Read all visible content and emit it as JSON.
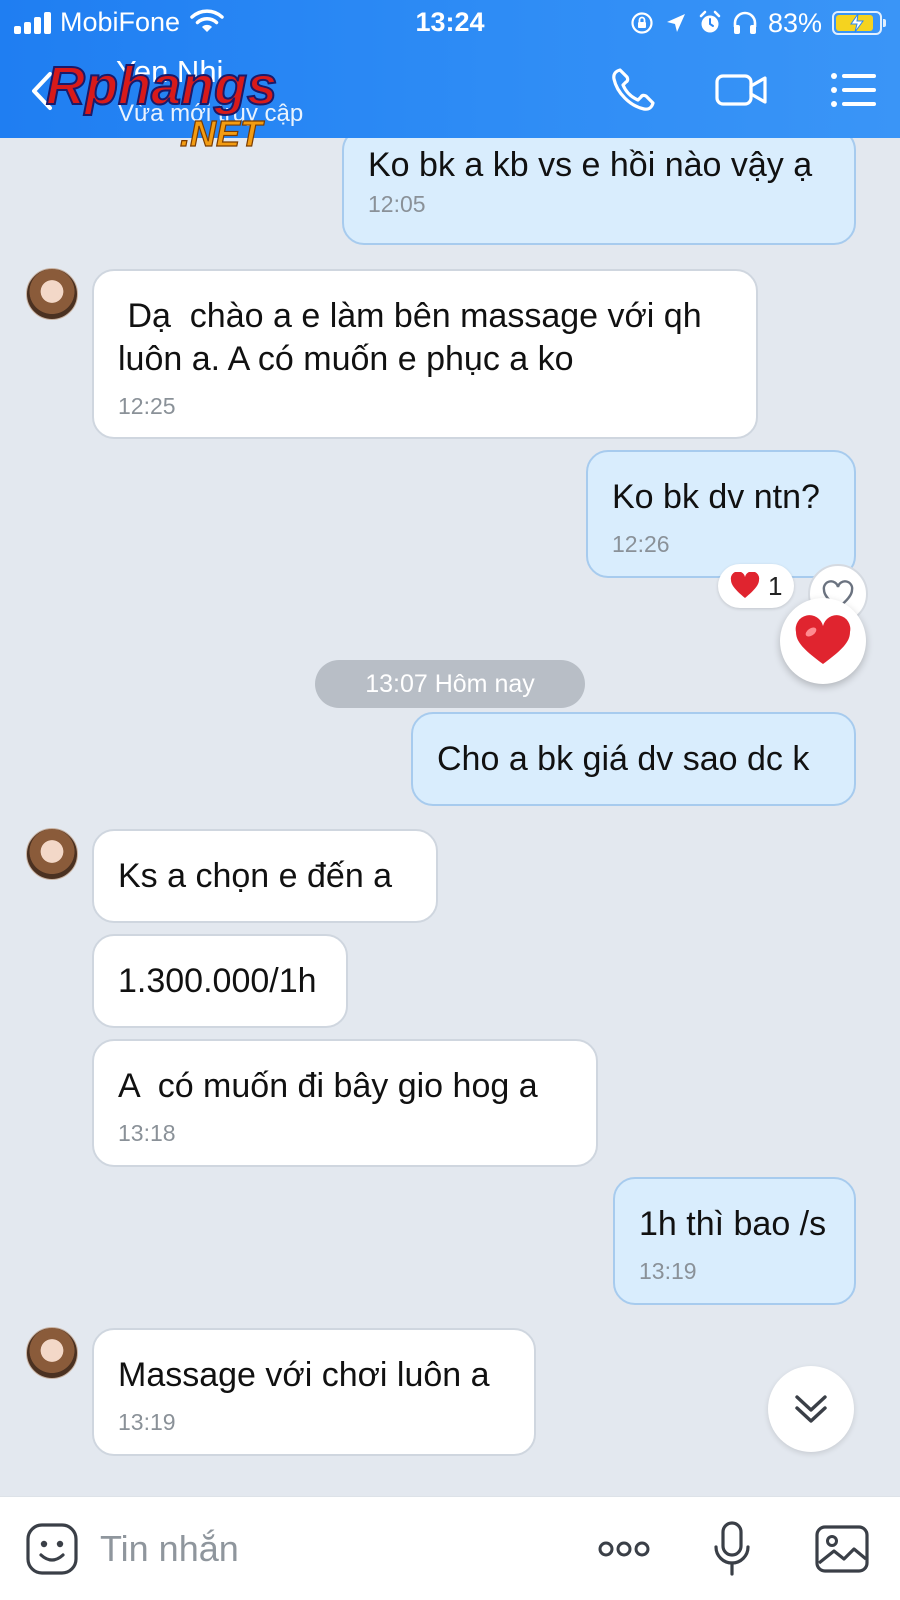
{
  "status_bar": {
    "carrier": "MobiFone",
    "time": "13:24",
    "battery_percent": "83%"
  },
  "header": {
    "contact_name": "Yen Nhi",
    "contact_status": "Vừa mới truy cập"
  },
  "watermark": {
    "brand": "Rphangs",
    "suffix": ".NET"
  },
  "messages": [
    {
      "side": "out",
      "text": "Ko bk a kb vs e hồi nào vậy ạ",
      "time": "12:05"
    },
    {
      "side": "in",
      "text": " Dạ  chào a e làm bên massage với qh\nluôn a. A có muốn e phục a ko",
      "time": "12:25"
    },
    {
      "side": "out",
      "text": "Ko bk dv ntn?",
      "time": "12:26"
    },
    {
      "side": "out",
      "text": "Cho a bk giá dv sao dc k",
      "time": ""
    },
    {
      "side": "in",
      "text": "Ks a chọn e đến a",
      "time": ""
    },
    {
      "side": "in",
      "text": "1.300.000/1h",
      "time": ""
    },
    {
      "side": "in",
      "text": "A  có muốn đi bây gio hog a",
      "time": "13:18"
    },
    {
      "side": "out",
      "text": "1h thì bao /s",
      "time": "13:19"
    },
    {
      "side": "in",
      "text": "Massage với chơi luôn a",
      "time": "13:19"
    }
  ],
  "date_separator": "13:07 Hôm nay",
  "reaction": {
    "emoji": "❤️",
    "count": "1"
  },
  "input": {
    "placeholder": "Tin nhắn"
  },
  "colors": {
    "header": "#2a86f4",
    "outgoing_bubble": "#d9edfd",
    "incoming_bubble": "#ffffff",
    "chat_background": "#e3e8ef",
    "heart": "#e0242f"
  }
}
